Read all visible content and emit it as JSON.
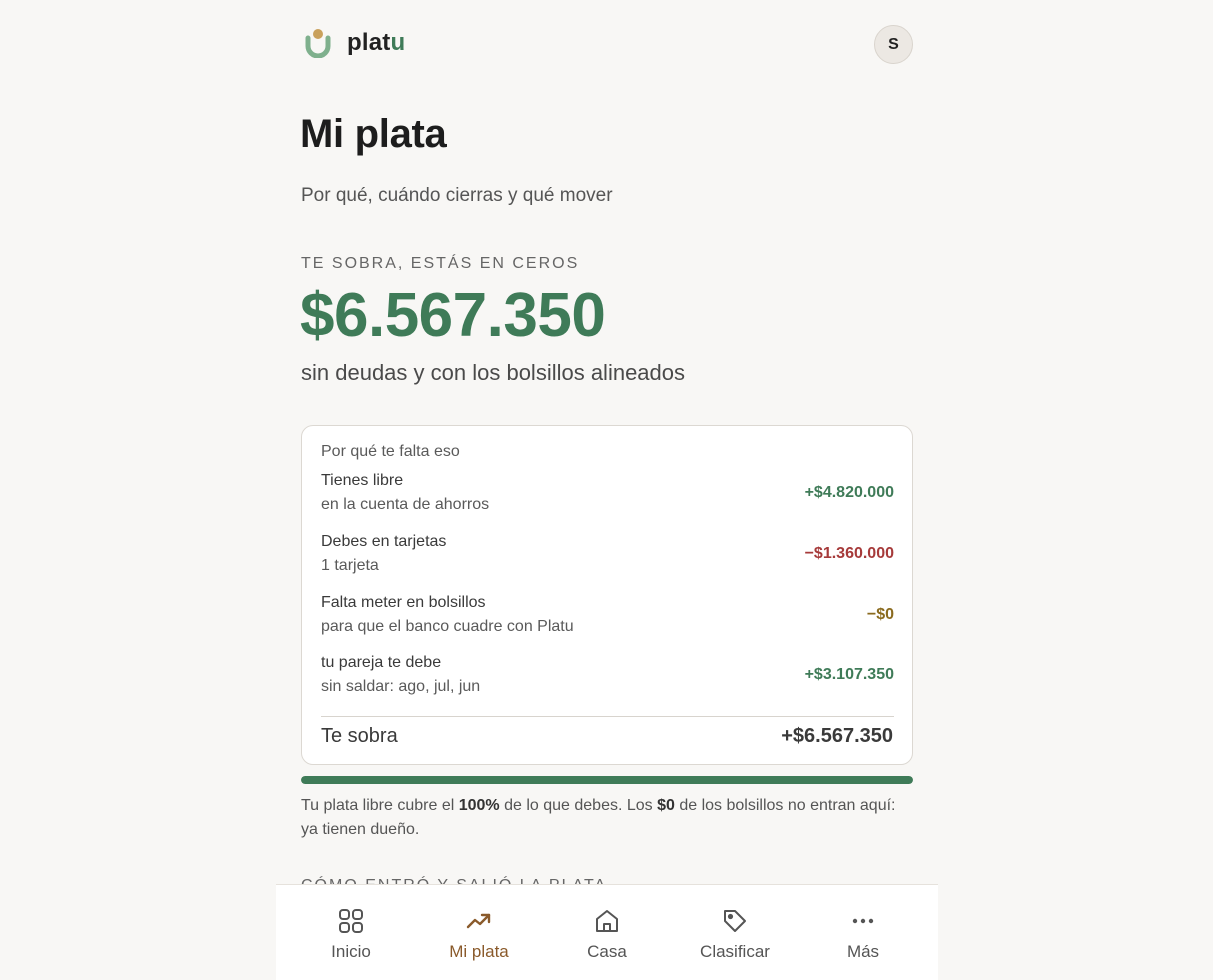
{
  "header": {
    "logo_text_main": "plat",
    "logo_text_accent": "u",
    "avatar_initial": "S"
  },
  "page": {
    "title": "Mi plata",
    "subtitle": "Por qué, cuándo cierras y qué mover"
  },
  "summary": {
    "overline": "TE SOBRA, ESTÁS EN CEROS",
    "amount": "$6.567.350",
    "note": "sin deudas y con los bolsillos alineados"
  },
  "breakdown": {
    "title": "Por qué te falta eso",
    "rows": [
      {
        "label": "Tienes libre",
        "sub": "en la cuenta de ahorros",
        "value": "+$4.820.000",
        "tone": "pos"
      },
      {
        "label": "Debes en tarjetas",
        "sub": "1 tarjeta",
        "value": "−$1.360.000",
        "tone": "neg"
      },
      {
        "label": "Falta meter en bolsillos",
        "sub": "para que el banco cuadre con Platu",
        "value": "−$0",
        "tone": "warn"
      },
      {
        "label": "tu pareja te debe",
        "sub": "sin saldar: ago, jul, jun",
        "value": "+$3.107.350",
        "tone": "pos"
      }
    ],
    "total_label": "Te sobra",
    "total_value": "+$6.567.350"
  },
  "coverage": {
    "percent": 100,
    "text_1": "Tu plata libre cubre el ",
    "percent_label": "100%",
    "text_2": " de lo que debes. Los ",
    "pockets_label": "$0",
    "text_3": " de los bolsillos no entran aquí: ya tienen dueño."
  },
  "next_section": {
    "title": "CÓMO ENTRÓ Y SALIÓ LA PLATA"
  },
  "nav": {
    "items": [
      {
        "label": "Inicio",
        "icon": "grid-icon"
      },
      {
        "label": "Mi plata",
        "icon": "trending-up-icon"
      },
      {
        "label": "Casa",
        "icon": "home-icon"
      },
      {
        "label": "Clasificar",
        "icon": "tag-icon"
      },
      {
        "label": "Más",
        "icon": "more-icon"
      }
    ],
    "active": "Mi plata"
  },
  "colors": {
    "green": "#3f7b58",
    "red": "#a63a3a",
    "amber": "#8a6a1e",
    "active_nav": "#8a5a2b",
    "logo_gold": "#c9a15c"
  }
}
